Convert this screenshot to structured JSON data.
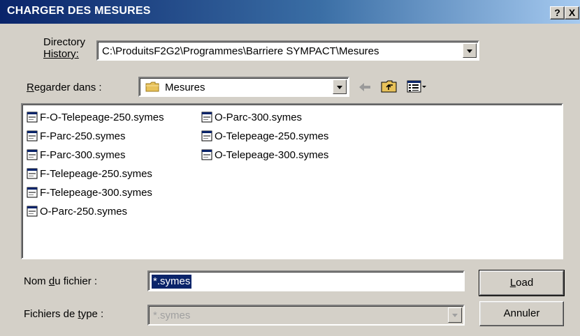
{
  "window": {
    "title": "CHARGER DES MESURES",
    "help_label": "?",
    "close_label": "X"
  },
  "history": {
    "label_line1": "Directory",
    "label_line2": "History:",
    "value": "C:\\ProduitsF2G2\\Programmes\\Barriere SYMPACT\\Mesures"
  },
  "lookin": {
    "label_u": "R",
    "label_rest": "egarder dans :",
    "value": "Mesures"
  },
  "files": [
    "F-O-Telepeage-250.symes",
    "F-Parc-250.symes",
    "F-Parc-300.symes",
    "F-Telepeage-250.symes",
    "F-Telepeage-300.symes",
    "O-Parc-250.symes",
    "O-Parc-300.symes",
    "O-Telepeage-250.symes",
    "O-Telepeage-300.symes"
  ],
  "filename": {
    "label_a": "Nom ",
    "label_u": "d",
    "label_b": "u fichier :",
    "value": "*.symes"
  },
  "filetype": {
    "label_a": "Fichiers de ",
    "label_u": "t",
    "label_b": "ype :",
    "value": "*.symes"
  },
  "buttons": {
    "load_u": "L",
    "load_rest": "oad",
    "cancel": "Annuler"
  },
  "icons": {
    "back": "back-arrow-icon",
    "up": "up-folder-icon",
    "view": "view-menu-icon",
    "folder": "folder-icon",
    "file": "file-icon"
  }
}
